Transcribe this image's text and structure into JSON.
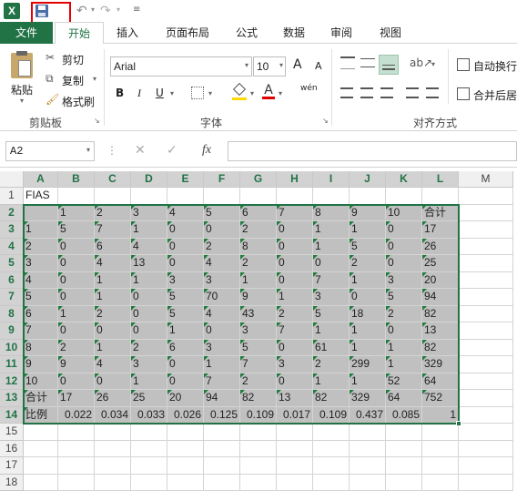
{
  "app": {
    "name_box": "A2",
    "font_name": "Arial",
    "font_size": "10",
    "accent": "#217346"
  },
  "tabs": [
    "文件",
    "开始",
    "插入",
    "页面布局",
    "公式",
    "数据",
    "审阅",
    "视图"
  ],
  "clipboard": {
    "paste": "粘贴",
    "cut": "剪切",
    "copy": "复制",
    "painter": "格式刷",
    "group": "剪贴板"
  },
  "font_group": {
    "group": "字体",
    "bold": "B",
    "italic": "I",
    "underline": "U",
    "wen": "wén",
    "grow": "A",
    "shrink": "A"
  },
  "align_group": {
    "group": "对齐方式",
    "wrap": "自动换行",
    "merge": "合并后居"
  },
  "formula": {
    "fx": "fx",
    "value": ""
  },
  "columns": [
    "A",
    "B",
    "C",
    "D",
    "E",
    "F",
    "G",
    "H",
    "I",
    "J",
    "K",
    "L",
    "M"
  ],
  "rows": [
    "1",
    "2",
    "3",
    "4",
    "5",
    "6",
    "7",
    "8",
    "9",
    "10",
    "11",
    "12",
    "13",
    "14",
    "15",
    "16",
    "17",
    "18"
  ],
  "sheet": [
    [
      "FIAS",
      "",
      "",
      "",
      "",
      "",
      "",
      "",
      "",
      "",
      "",
      ""
    ],
    [
      "",
      "1",
      "2",
      "3",
      "4",
      "5",
      "6",
      "7",
      "8",
      "9",
      "10",
      "合计"
    ],
    [
      "1",
      "5",
      "7",
      "1",
      "0",
      "0",
      "2",
      "0",
      "1",
      "1",
      "0",
      "17"
    ],
    [
      "2",
      "0",
      "6",
      "4",
      "0",
      "2",
      "8",
      "0",
      "1",
      "5",
      "0",
      "26"
    ],
    [
      "3",
      "0",
      "4",
      "13",
      "0",
      "4",
      "2",
      "0",
      "0",
      "2",
      "0",
      "25"
    ],
    [
      "4",
      "0",
      "1",
      "1",
      "3",
      "3",
      "1",
      "0",
      "7",
      "1",
      "3",
      "20"
    ],
    [
      "5",
      "0",
      "1",
      "0",
      "5",
      "70",
      "9",
      "1",
      "3",
      "0",
      "5",
      "94"
    ],
    [
      "6",
      "1",
      "2",
      "0",
      "5",
      "4",
      "43",
      "2",
      "5",
      "18",
      "2",
      "82"
    ],
    [
      "7",
      "0",
      "0",
      "0",
      "1",
      "0",
      "3",
      "7",
      "1",
      "1",
      "0",
      "13"
    ],
    [
      "8",
      "2",
      "1",
      "2",
      "6",
      "3",
      "5",
      "0",
      "61",
      "1",
      "1",
      "82"
    ],
    [
      "9",
      "9",
      "4",
      "3",
      "0",
      "1",
      "7",
      "3",
      "2",
      "299",
      "1",
      "329"
    ],
    [
      "10",
      "0",
      "0",
      "1",
      "0",
      "7",
      "2",
      "0",
      "1",
      "1",
      "52",
      "64"
    ],
    [
      "合计",
      "17",
      "26",
      "25",
      "20",
      "94",
      "82",
      "13",
      "82",
      "329",
      "64",
      "752"
    ],
    [
      "比例",
      "0.022",
      "0.034",
      "0.033",
      "0.026",
      "0.125",
      "0.109",
      "0.017",
      "0.109",
      "0.437",
      "0.085",
      "1"
    ]
  ]
}
